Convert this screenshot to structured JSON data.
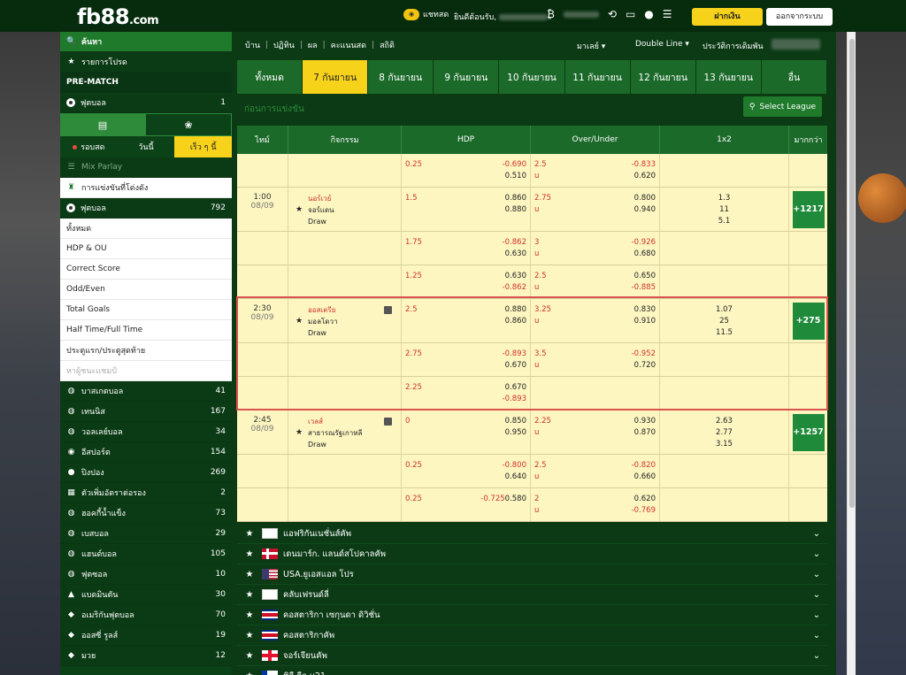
{
  "header": {
    "logo": "fb88",
    "logo_domain": ".com",
    "chat_label": "แชทสด",
    "welcome": "ยินดีต้อนรับ,",
    "deposit_label": "ฝากเงิน",
    "logout_label": "ออกจากระบบ"
  },
  "sidebar": {
    "search_label": "ค้นหา",
    "fav_label": "รายการโปรด",
    "prematch_label": "PRE-MATCH",
    "football_top": {
      "label": "ฟุตบอล",
      "count": "1"
    },
    "tabs": [
      "รอบสด",
      "วันนี้",
      "เร็ว ๆ นี้"
    ],
    "mix_parlay": "Mix Parlay",
    "popular": "การแข่งขันที่โด่งดัง",
    "football": {
      "label": "ฟุตบอล",
      "count": "792"
    },
    "sub_items": [
      "ทั้งหมด",
      "HDP & OU",
      "Correct Score",
      "Odd/Even",
      "Total Goals",
      "Half Time/Full Time",
      "ประตูแรก/ประตูสุดท้าย",
      "หาผู้ชนะแชมป์"
    ],
    "sports": [
      {
        "label": "บาสเกตบอล",
        "count": "41",
        "icon": "basketball-icon"
      },
      {
        "label": "เทนนิส",
        "count": "167",
        "icon": "tennis-icon"
      },
      {
        "label": "วอลเลย์บอล",
        "count": "34",
        "icon": "volleyball-icon"
      },
      {
        "label": "อีสปอร์ต",
        "count": "154",
        "icon": "esports-icon"
      },
      {
        "label": "ปิงปอง",
        "count": "269",
        "icon": "table-tennis-icon"
      },
      {
        "label": "ตัวเพิ่มอัตราต่อรอง",
        "count": "2",
        "icon": "odds-boost-icon"
      },
      {
        "label": "ฮอคกี้น้ำแข็ง",
        "count": "73",
        "icon": "ice-hockey-icon"
      },
      {
        "label": "เบสบอล",
        "count": "29",
        "icon": "baseball-icon"
      },
      {
        "label": "แฮนด์บอล",
        "count": "105",
        "icon": "handball-icon"
      },
      {
        "label": "ฟุตซอล",
        "count": "10",
        "icon": "futsal-icon"
      },
      {
        "label": "แบดมินตัน",
        "count": "30",
        "icon": "badminton-icon"
      },
      {
        "label": "อเมริกันฟุตบอล",
        "count": "70",
        "icon": "american-football-icon"
      },
      {
        "label": "ออสซี่ รูลส์",
        "count": "19",
        "icon": "aussie-rules-icon"
      },
      {
        "label": "มวย",
        "count": "12",
        "icon": "boxing-icon"
      }
    ]
  },
  "main": {
    "nav": [
      "บ้าน",
      "ปฏิทิน",
      "ผล",
      "คะแนนสด",
      "สถิติ"
    ],
    "lang": "มาเลย์",
    "line": "Double Line",
    "history": "ประวัติการเดิมพัน",
    "dates": [
      "ทั้งหมด",
      "7 กันยายน",
      "8 กันยายน",
      "9 กันยายน",
      "10 กันยายน",
      "11 กันยายน",
      "12 กันยายน",
      "13 กันยายน",
      "อื่น"
    ],
    "section_title": "ก่อนการแข่งขัน",
    "select_league": "Select League",
    "headers": [
      "ไทม์",
      "กิจกรรม",
      "HDP",
      "Over/Under",
      "1x2",
      "มากกว่า"
    ]
  },
  "rows": [
    {
      "hdp": [
        "0.25",
        "-0.690",
        "",
        "0.510"
      ],
      "ou": [
        "2.5",
        "-0.833",
        "u",
        "0.620"
      ]
    },
    {
      "time": "1:00",
      "date": "08/09",
      "home": "นอร์เวย์",
      "away": "จอร์แดน",
      "draw": "Draw",
      "hdp": [
        "1.5",
        "0.860",
        "",
        "0.880"
      ],
      "ou": [
        "2.75",
        "0.800",
        "u",
        "0.940"
      ],
      "x12": [
        "1.3",
        "11",
        "5.1"
      ],
      "more": "+1217"
    },
    {
      "hdp": [
        "1.75",
        "-0.862",
        "",
        "0.630"
      ],
      "ou": [
        "3",
        "-0.926",
        "u",
        "0.680"
      ]
    },
    {
      "hdp": [
        "1.25",
        "0.630",
        "",
        "-0.862"
      ],
      "ou": [
        "2.5",
        "0.650",
        "u",
        "-0.885"
      ]
    },
    {
      "time": "2:30",
      "date": "08/09",
      "home": "ออสเตรีย",
      "away": "มอลโดวา",
      "draw": "Draw",
      "hdp": [
        "2.5",
        "0.880",
        "",
        "0.860"
      ],
      "ou": [
        "3.25",
        "0.830",
        "u",
        "0.910"
      ],
      "x12": [
        "1.07",
        "25",
        "11.5"
      ],
      "more": "+275"
    },
    {
      "hdp": [
        "2.75",
        "-0.893",
        "",
        "0.670"
      ],
      "ou": [
        "3.5",
        "-0.952",
        "u",
        "0.720"
      ]
    },
    {
      "hdp": [
        "2.25",
        "0.670",
        "",
        "-0.893"
      ],
      "ou": [
        "",
        "",
        "",
        ""
      ]
    },
    {
      "time": "2:45",
      "date": "08/09",
      "home": "เวลส์",
      "away": "สาธารณรัฐเกาหลี",
      "draw": "Draw",
      "hdp": [
        "0",
        "0.850",
        "",
        "0.950"
      ],
      "ou": [
        "2.25",
        "0.930",
        "u",
        "0.870"
      ],
      "x12": [
        "2.63",
        "2.77",
        "3.15"
      ],
      "more": "+1257"
    },
    {
      "hdp": [
        "0.25",
        "-0.800",
        "",
        "0.640"
      ],
      "ou": [
        "2.5",
        "-0.820",
        "u",
        "0.660"
      ]
    },
    {
      "hdp": [
        "",
        "0.580",
        "0.25",
        "-0.725"
      ],
      "ou": [
        "2",
        "0.620",
        "u",
        "-0.769"
      ]
    }
  ],
  "leagues": [
    {
      "name": "แอฟริกันเนชั่นส์คัพ",
      "flag": "africa"
    },
    {
      "name": "เดนมาร์ก. แลนด์สโปคาลคัพ",
      "flag": "denmark"
    },
    {
      "name": "USA.ยูเอสแอล โปร",
      "flag": "usa"
    },
    {
      "name": "คลับเฟรนด์ลี่",
      "flag": "globe"
    },
    {
      "name": "คอสตาริกา เซกุนดา ดิวิชั่น",
      "flag": "costarica"
    },
    {
      "name": "คอสตาริกาคัพ",
      "flag": "costarica"
    },
    {
      "name": "จอร์เจียนคัพ",
      "flag": "georgia"
    },
    {
      "name": "ชิลี ลีก u21",
      "flag": "chile"
    }
  ]
}
